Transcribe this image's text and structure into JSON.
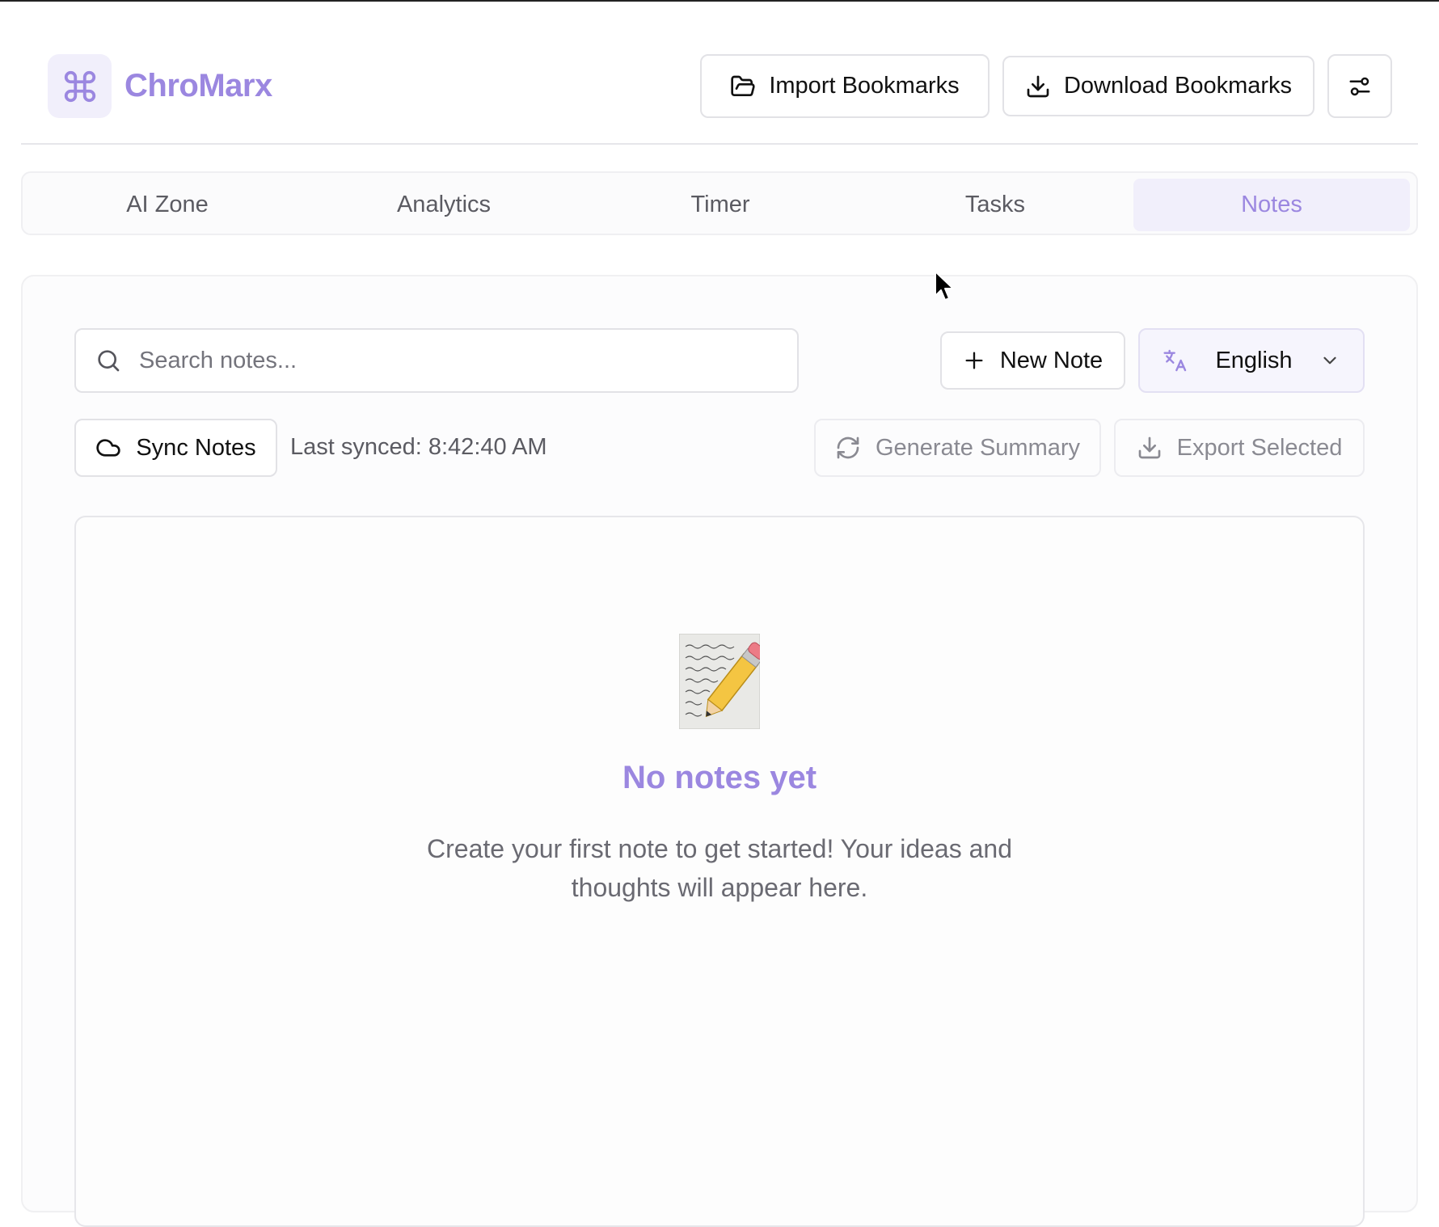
{
  "app": {
    "name": "ChroMarx",
    "logo_icon": "command-icon",
    "accent_color": "#9b87e0"
  },
  "header": {
    "import_label": "Import Bookmarks",
    "download_label": "Download Bookmarks",
    "settings_icon": "sliders-icon"
  },
  "tabs": [
    {
      "label": "AI Zone",
      "active": false
    },
    {
      "label": "Analytics",
      "active": false
    },
    {
      "label": "Timer",
      "active": false
    },
    {
      "label": "Tasks",
      "active": false
    },
    {
      "label": "Notes",
      "active": true
    }
  ],
  "notes": {
    "search_placeholder": "Search notes...",
    "new_note_label": "New Note",
    "language": "English",
    "sync_label": "Sync Notes",
    "last_synced": "Last synced: 8:42:40 AM",
    "generate_summary_label": "Generate Summary",
    "export_selected_label": "Export Selected",
    "empty_icon": "memo-icon",
    "empty_title": "No notes yet",
    "empty_description": "Create your first note to get started! Your ideas and thoughts will appear here."
  }
}
